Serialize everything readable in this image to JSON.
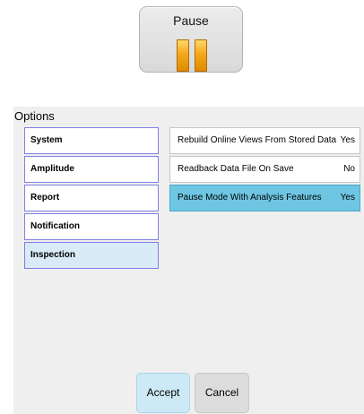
{
  "pause": {
    "label": "Pause",
    "icon": "pause-icon",
    "icon_color": "#f5a81c"
  },
  "options": {
    "title": "Options",
    "categories": [
      {
        "label": "System"
      },
      {
        "label": "Amplitude"
      },
      {
        "label": "Report"
      },
      {
        "label": "Notification"
      },
      {
        "label": "Inspection",
        "selected": true
      }
    ],
    "settings": [
      {
        "name": "Rebuild Online Views From Stored Data",
        "value": "Yes"
      },
      {
        "name": "Readback Data File On Save",
        "value": "No"
      },
      {
        "name": "Pause Mode With Analysis Features",
        "value": "Yes",
        "selected": true
      }
    ],
    "selected_color": "#6ec6e2"
  },
  "buttons": {
    "accept_label": "Accept",
    "cancel_label": "Cancel"
  }
}
